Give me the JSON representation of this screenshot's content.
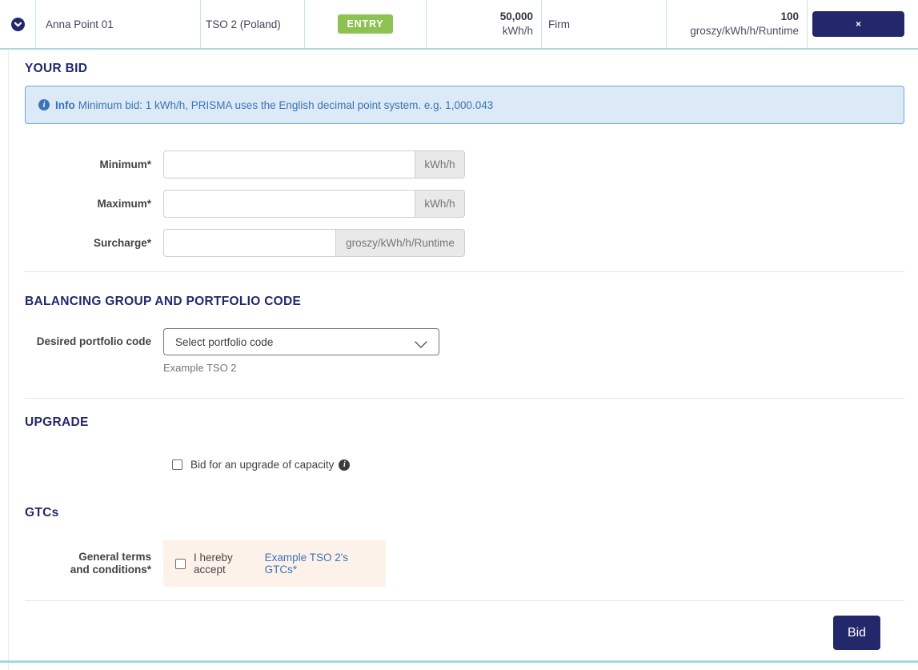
{
  "row": {
    "point_name": "Anna Point 01",
    "operator": "TSO 2 (Poland)",
    "direction_badge": "ENTRY",
    "capacity_value": "50,000",
    "capacity_unit": "kWh/h",
    "capacity_quality": "Firm",
    "price_value": "100",
    "price_unit": "groszy/kWh/h/Runtime",
    "collapse_label": "×"
  },
  "your_bid": {
    "heading": "YOUR BID",
    "info_label": "Info",
    "info_text": "Minimum bid: 1 kWh/h, PRISMA uses the English decimal point system. e.g. 1,000.043",
    "minimum": {
      "label": "Minimum*",
      "value": "",
      "unit": "kWh/h"
    },
    "maximum": {
      "label": "Maximum*",
      "value": "",
      "unit": "kWh/h"
    },
    "surcharge": {
      "label": "Surcharge*",
      "value": "",
      "unit": "groszy/kWh/h/Runtime"
    }
  },
  "portfolio": {
    "heading": "BALANCING GROUP AND PORTFOLIO CODE",
    "label": "Desired portfolio code",
    "selected_option": "Select portfolio code",
    "help_text": "Example TSO 2"
  },
  "upgrade": {
    "heading": "UPGRADE",
    "checkbox_label": "Bid for an upgrade of capacity"
  },
  "gtcs": {
    "heading": "GTCs",
    "label_line1": "General terms",
    "label_line2": "and conditions*",
    "accept_text": "I hereby accept",
    "accept_link": "Example TSO 2's GTCs*"
  },
  "actions": {
    "bid_button": "Bid"
  },
  "icons": {
    "row_toggle": "chevron-down-circle-icon",
    "info_box": "info-icon",
    "upgrade_info": "info-icon",
    "select": "chevron-down-icon",
    "close": "x-icon"
  },
  "colors": {
    "navy": "#23286B",
    "teal_border": "#A7D8DB",
    "badge_green": "#8DC152",
    "info_bg": "#DCE9F6",
    "info_border": "#6FA4D8",
    "info_text": "#3A74B8",
    "link_blue": "#3A74B8",
    "gtc_bg": "#FDF2E9",
    "divider": "#E2E2E2"
  }
}
